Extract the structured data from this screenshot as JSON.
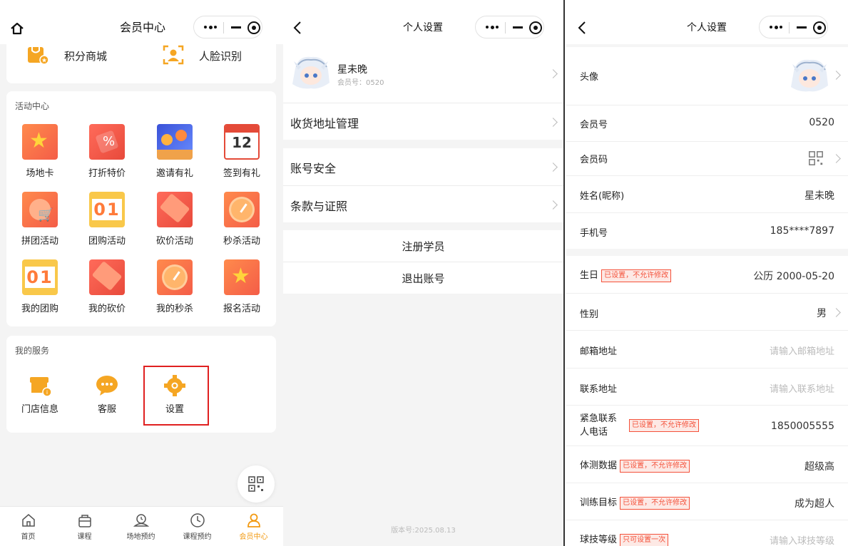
{
  "panel1": {
    "title": "会员中心",
    "top_links": [
      {
        "label": "积分商城",
        "icon": "gift-shop-icon"
      },
      {
        "label": "人脸识别",
        "icon": "face-scan-icon"
      }
    ],
    "activity": {
      "title": "活动中心",
      "items": [
        {
          "label": "场地卡",
          "icon": "star-icon"
        },
        {
          "label": "打折特价",
          "icon": "discount-bag-icon"
        },
        {
          "label": "邀请有礼",
          "icon": "invite-icon"
        },
        {
          "label": "签到有礼",
          "icon": "calendar-icon",
          "digit": "12"
        },
        {
          "label": "拼团活动",
          "icon": "group-cart-icon"
        },
        {
          "label": "团购活动",
          "icon": "group-buy-icon",
          "digit": "01"
        },
        {
          "label": "砍价活动",
          "icon": "price-tag-icon"
        },
        {
          "label": "秒杀活动",
          "icon": "flash-clock-icon"
        },
        {
          "label": "我的团购",
          "icon": "my-group-buy-icon",
          "digit": "01"
        },
        {
          "label": "我的砍价",
          "icon": "my-price-tag-icon"
        },
        {
          "label": "我的秒杀",
          "icon": "my-flash-clock-icon"
        },
        {
          "label": "报名活动",
          "icon": "signup-star-icon"
        }
      ]
    },
    "services": {
      "title": "我的服务",
      "items": [
        {
          "label": "门店信息",
          "icon": "store-info-icon"
        },
        {
          "label": "客服",
          "icon": "chat-bubble-icon"
        },
        {
          "label": "设置",
          "icon": "gear-icon"
        }
      ],
      "highlight_color": "#e02020"
    },
    "tabs": [
      {
        "label": "首页",
        "icon": "home-tab-icon"
      },
      {
        "label": "课程",
        "icon": "bag-tab-icon"
      },
      {
        "label": "场地预约",
        "icon": "venue-tab-icon"
      },
      {
        "label": "课程预约",
        "icon": "clock-tab-icon"
      },
      {
        "label": "会员中心",
        "icon": "person-tab-icon",
        "active": true
      }
    ],
    "accent_color": "#f29a12"
  },
  "panel2": {
    "title": "个人设置",
    "profile": {
      "name": "星未晚",
      "member_no": "会员号：0520"
    },
    "menu": [
      {
        "label": "收货地址管理"
      },
      {
        "label": "账号安全"
      },
      {
        "label": "条款与证照"
      }
    ],
    "actions": [
      {
        "label": "注册学员"
      },
      {
        "label": "退出账号"
      }
    ],
    "version": "版本号:2025.08.13"
  },
  "panel3": {
    "title": "个人设置",
    "fields": {
      "avatar": {
        "label": "头像"
      },
      "member_no": {
        "label": "会员号",
        "value": "0520"
      },
      "member_code": {
        "label": "会员码"
      },
      "name": {
        "label": "姓名(昵称)",
        "value": "星未晚"
      },
      "phone": {
        "label": "手机号",
        "value": "185****7897"
      },
      "birthday": {
        "label": "生日",
        "badge": "已设置，不允许修改",
        "value": "公历 2000-05-20"
      },
      "gender": {
        "label": "性别",
        "value": "男"
      },
      "email": {
        "label": "邮箱地址",
        "placeholder": "请输入邮箱地址"
      },
      "address": {
        "label": "联系地址",
        "placeholder": "请输入联系地址"
      },
      "emergency": {
        "label_line1": "紧急联系",
        "label_line2": "人电话",
        "badge": "已设置，不允许修改",
        "value": "1850005555"
      },
      "body_data": {
        "label": "体测数据",
        "badge": "已设置，不允许修改",
        "value": "超级高"
      },
      "goal": {
        "label": "训练目标",
        "badge": "已设置，不允许修改",
        "value": "成为超人"
      },
      "skill": {
        "label": "球技等级",
        "badge": "只可设置一次",
        "placeholder": "请输入球技等级"
      }
    },
    "badge_color": "#f4523b"
  }
}
